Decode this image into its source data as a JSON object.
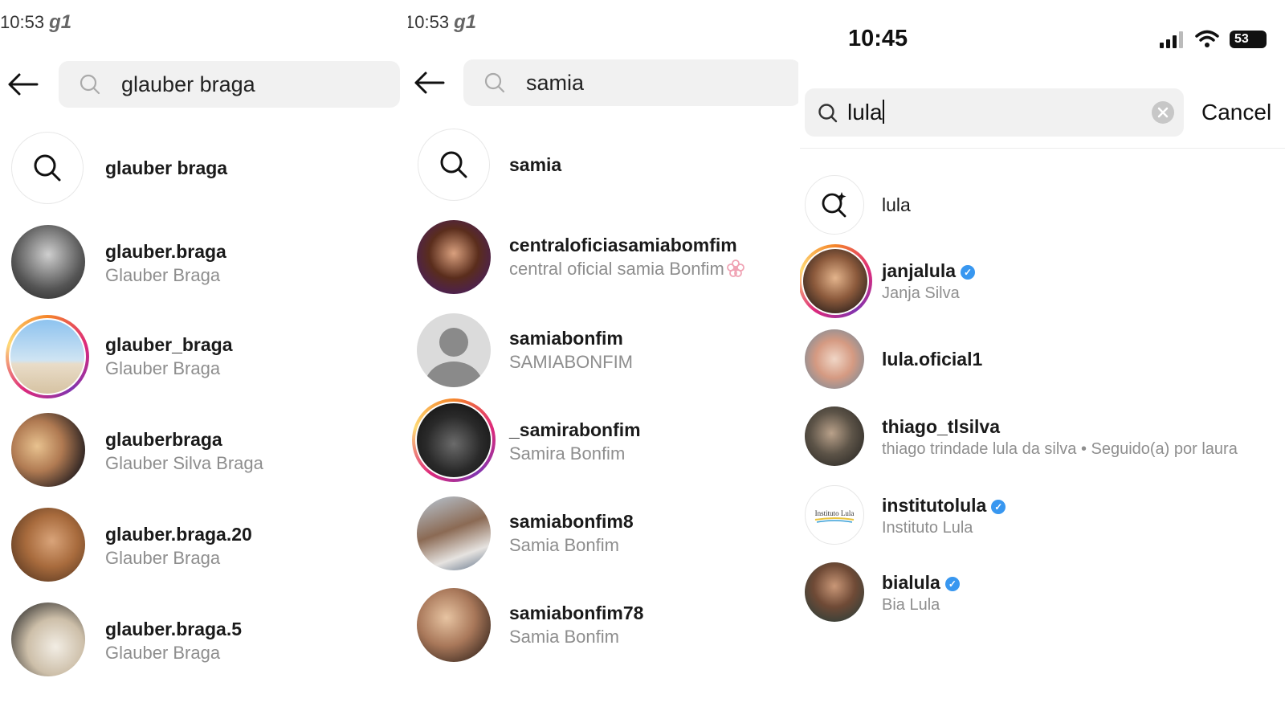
{
  "panel1": {
    "time": "10:53",
    "carrier": "g1",
    "search_value": "glauber braga",
    "suggestion": "glauber braga",
    "results": [
      {
        "username": "glauber.braga",
        "fullname": "Glauber Braga"
      },
      {
        "username": "glauber_braga",
        "fullname": "Glauber Braga"
      },
      {
        "username": "glauberbraga",
        "fullname": "Glauber Silva Braga"
      },
      {
        "username": "glauber.braga.20",
        "fullname": "Glauber Braga"
      },
      {
        "username": "glauber.braga.5",
        "fullname": "Glauber Braga"
      }
    ]
  },
  "panel2": {
    "time": "10:53",
    "carrier": "g1",
    "search_value": "samia",
    "suggestion": "samia",
    "results": [
      {
        "username": "centraloficiasamiabomfim",
        "fullname": "central oficial samia Bonfim"
      },
      {
        "username": "samiabonfim",
        "fullname": "SAMIABONFIM"
      },
      {
        "username": "_samirabonfim",
        "fullname": "Samira Bonfim"
      },
      {
        "username": "samiabonfim8",
        "fullname": "Samia Bonfim"
      },
      {
        "username": "samiabonfim78",
        "fullname": "Samia Bonfim"
      }
    ]
  },
  "panel3": {
    "time": "10:45",
    "battery": "53",
    "search_value": "lula",
    "cancel_label": "Cancel",
    "suggestion": "lula",
    "results": [
      {
        "username": "janjalula",
        "fullname": "Janja Silva",
        "verified": true
      },
      {
        "username": "lula.oficial1",
        "fullname": "",
        "verified": false
      },
      {
        "username": "thiago_tlsilva",
        "fullname": "thiago trindade lula da silva • Seguido(a) por laura",
        "verified": false
      },
      {
        "username": "institutolula",
        "fullname": "Instituto Lula",
        "verified": true
      },
      {
        "username": "bialula",
        "fullname": "Bia Lula",
        "verified": true
      }
    ],
    "logo_text": "Instituto Lula"
  },
  "colors": {
    "verified": "#3897f0",
    "secondary_text": "#8e8e8e",
    "search_bg": "#f1f1f1"
  }
}
